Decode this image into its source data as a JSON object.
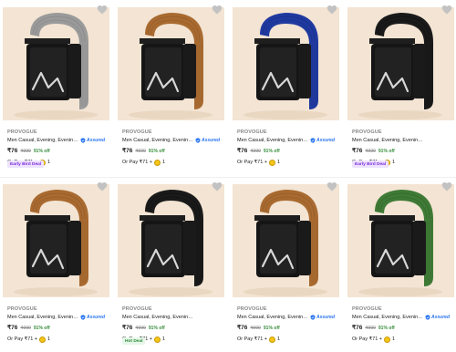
{
  "products": [
    {
      "brand": "PROVOGUE",
      "title": "Men Casual, Evening, Evening, P...",
      "assured": "Assured",
      "price": "₹76",
      "mrp": "₹999",
      "off": "91% off",
      "pay": "Or Pay ₹71 +",
      "coins": "1",
      "deal": "Early Bird Deal",
      "deal_type": "early",
      "strap_color": "#9a9a9a",
      "strap_dark": "#7d7d7d"
    },
    {
      "brand": "PROVOGUE",
      "title": "Men Casual, Evening, Evening, P...",
      "assured": "Assured",
      "price": "₹76",
      "mrp": "₹999",
      "off": "91% off",
      "pay": "Or Pay ₹71 +",
      "coins": "1",
      "deal": "",
      "deal_type": "",
      "strap_color": "#a86a30",
      "strap_dark": "#8a5424"
    },
    {
      "brand": "PROVOGUE",
      "title": "Men Casual, Evening, Evening, P...",
      "assured": "Assured",
      "price": "₹76",
      "mrp": "₹999",
      "off": "91% off",
      "pay": "Or Pay ₹71 +",
      "coins": "1",
      "deal": "",
      "deal_type": "",
      "strap_color": "#1f3aa0",
      "strap_dark": "#152a7a"
    },
    {
      "brand": "PROVOGUE",
      "title": "Men Casual, Evening, Evening, Party Black N...",
      "assured": "",
      "price": "₹76",
      "mrp": "₹999",
      "off": "91% off",
      "pay": "Or Pay ₹71 +",
      "coins": "1",
      "deal": "Early Bird Deal",
      "deal_type": "early",
      "strap_color": "#1a1a1a",
      "strap_dark": "#0c0c0c"
    },
    {
      "brand": "PROVOGUE",
      "title": "Men Casual, Evening, Evening, P...",
      "assured": "Assured",
      "price": "₹76",
      "mrp": "₹999",
      "off": "91% off",
      "pay": "Or Pay ₹71 +",
      "coins": "1",
      "deal": "",
      "deal_type": "",
      "strap_color": "#a86a30",
      "strap_dark": "#8a5424"
    },
    {
      "brand": "PROVOGUE",
      "title": "Men Casual, Evening, Evening, Party Black N...",
      "assured": "",
      "price": "₹76",
      "mrp": "₹999",
      "off": "91% off",
      "pay": "Or Pay ₹71 +",
      "coins": "1",
      "deal": "Hot Deal",
      "deal_type": "hot",
      "strap_color": "#1a1a1a",
      "strap_dark": "#0c0c0c"
    },
    {
      "brand": "PROVOGUE",
      "title": "Men Casual, Evening, Evening, P...",
      "assured": "Assured",
      "price": "₹76",
      "mrp": "₹999",
      "off": "91% off",
      "pay": "Or Pay ₹71 +",
      "coins": "1",
      "deal": "",
      "deal_type": "",
      "strap_color": "#a86a30",
      "strap_dark": "#8a5424"
    },
    {
      "brand": "PROVOGUE",
      "title": "Men Casual, Evening, Evening, P...",
      "assured": "Assured",
      "price": "₹76",
      "mrp": "₹999",
      "off": "91% off",
      "pay": "Or Pay ₹71 +",
      "coins": "1",
      "deal": "",
      "deal_type": "",
      "strap_color": "#3f7a36",
      "strap_dark": "#2f5e28"
    }
  ],
  "icons": {
    "wishlist": "heart-icon",
    "assured": "shield-icon",
    "coin": "coin-icon"
  },
  "colors": {
    "image_bg": "#f3e4d3",
    "assured_blue": "#2874f0",
    "discount_green": "#388e3c",
    "early_bird_purple": "#7b2ad8",
    "hot_deal_green": "#2e8b3a"
  }
}
